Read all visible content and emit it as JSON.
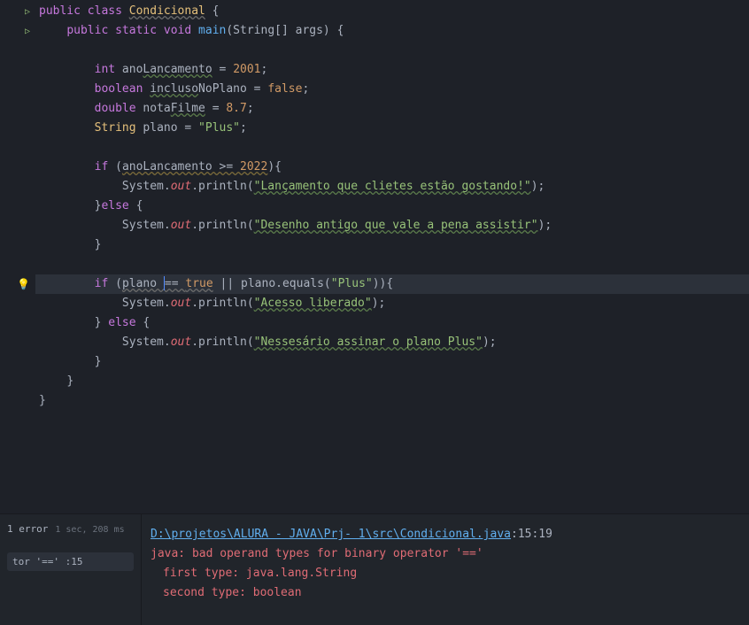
{
  "code": {
    "l1": {
      "kw_public": "public",
      "kw_class": "class",
      "cls": "Condicional",
      "brace": " {"
    },
    "l2": {
      "kw_public": "public",
      "kw_static": "static",
      "kw_void": "void",
      "method": "main",
      "params": "(String[] args) {"
    },
    "l4": {
      "type": "int",
      "var": " ano",
      "var2": "Lancamento",
      "eq": " = ",
      "val": "2001",
      "semi": ";"
    },
    "l5": {
      "type": "boolean",
      "var": " ",
      "var2": "incluso",
      "var3": "NoPlano",
      "eq": " = ",
      "val": "false",
      "semi": ";"
    },
    "l6": {
      "type": "double",
      "var": " nota",
      "var2": "Filme",
      "eq": " = ",
      "val": "8.7",
      "semi": ";"
    },
    "l7": {
      "type": "String",
      "var": " plano = ",
      "str": "\"Plus\"",
      "semi": ";"
    },
    "l9": {
      "kw": "if",
      "open": " (",
      "cond": "anoLancamento >= ",
      "val": "2022",
      "close": "){"
    },
    "l10": {
      "sys": "System.",
      "out": "out",
      "print": ".println(",
      "str": "\"Lançamento que clietes estão gostando!\"",
      "close": ");"
    },
    "l11": {
      "brace": "}",
      "kw": "else",
      "open": " {"
    },
    "l12": {
      "sys": "System.",
      "out": "out",
      "print": ".println(",
      "str": "\"Desenho antigo que vale a pena assistir\"",
      "close": ");"
    },
    "l13": {
      "brace": "}"
    },
    "l15": {
      "kw": "if",
      "open": " (",
      "v1": "plano ",
      "op": "== ",
      "v2": "true",
      "or": " || ",
      "v3": "plano.equals(",
      "str": "\"Plus\"",
      "close": ")){"
    },
    "l16": {
      "sys": "System.",
      "out": "out",
      "print": ".println(",
      "str": "\"Acesso liberado\"",
      "close": ");"
    },
    "l17": {
      "brace": "} ",
      "kw": "else",
      "open": " {"
    },
    "l18": {
      "sys": "System.",
      "out": "out",
      "print": ".println(",
      "str": "\"Nessesário assinar o plano Plus\"",
      "close": ");"
    },
    "l19": {
      "brace": "}"
    },
    "l20": {
      "brace": "}"
    },
    "l21": {
      "brace": "}"
    }
  },
  "build": {
    "status": "1 error",
    "time": "1 sec, 208 ms",
    "error_item": "tor '=='  :15"
  },
  "error": {
    "path": "D:\\projetos\\ALURA - JAVA\\Prj- 1\\src\\Condicional.java",
    "loc": ":15:19",
    "msg": "java: bad operand types for binary operator '=='",
    "d1": "first type:  java.lang.String",
    "d2": "second type: boolean"
  }
}
